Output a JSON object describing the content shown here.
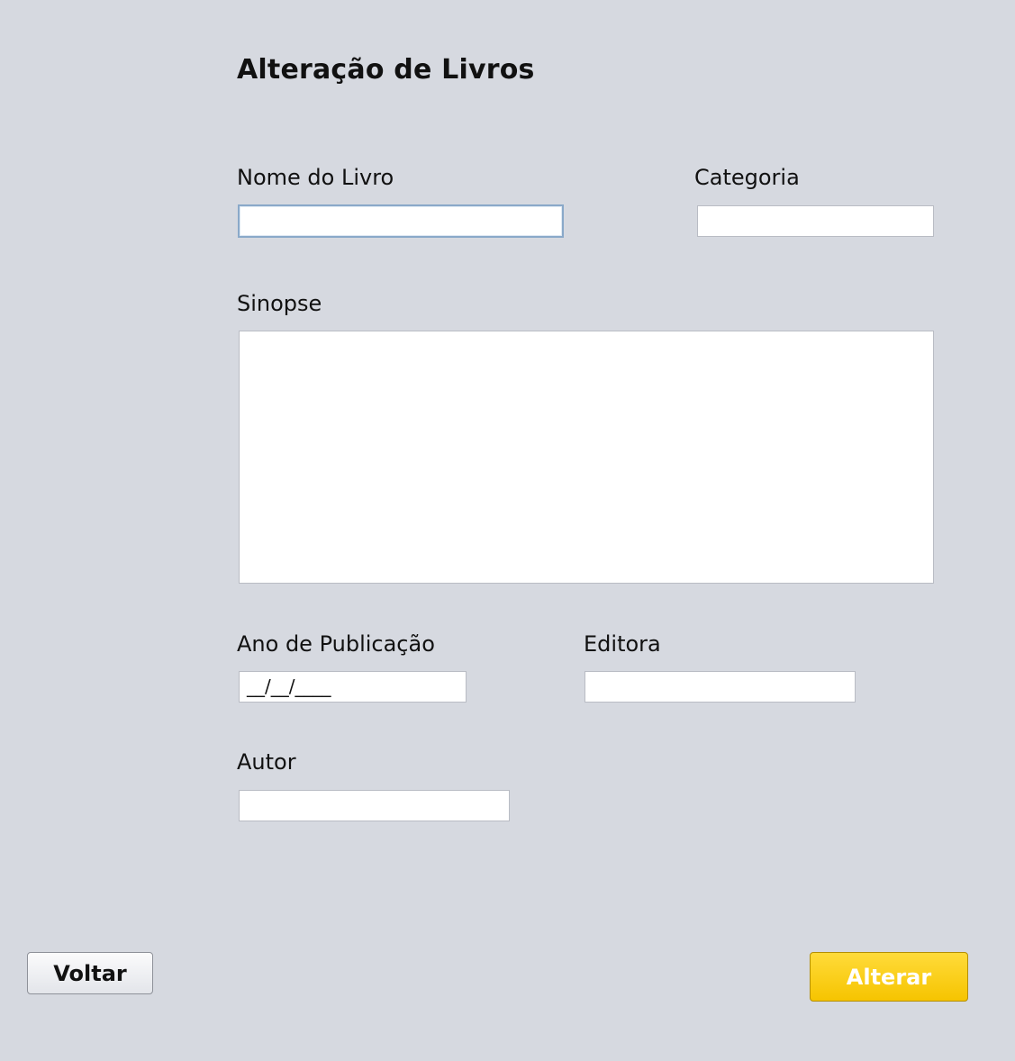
{
  "page": {
    "title": "Alteração de Livros"
  },
  "form": {
    "nome_do_livro": {
      "label": "Nome do Livro",
      "value": ""
    },
    "categoria": {
      "label": "Categoria",
      "value": ""
    },
    "sinopse": {
      "label": "Sinopse",
      "value": ""
    },
    "ano_de_publicacao": {
      "label": "Ano de Publicação",
      "mask": "__/__/____"
    },
    "editora": {
      "label": "Editora",
      "value": ""
    },
    "autor": {
      "label": "Autor",
      "value": ""
    }
  },
  "buttons": {
    "voltar": "Voltar",
    "alterar": "Alterar"
  },
  "colors": {
    "background": "#d6d9e0",
    "primary_button": "#f6c400",
    "focus_border": "#8aa9c9"
  }
}
